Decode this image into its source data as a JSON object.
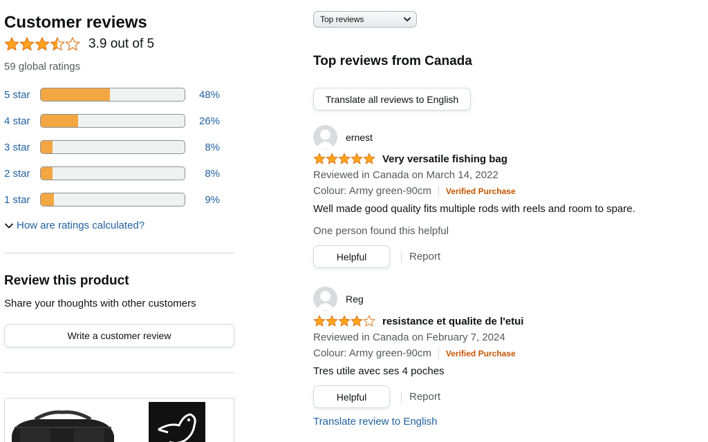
{
  "summary": {
    "title": "Customer reviews",
    "average_rating": 3.9,
    "average_text": "3.9 out of 5",
    "global_ratings": "59 global ratings",
    "histogram": [
      {
        "label": "5 star",
        "percent": 48,
        "percent_text": "48%"
      },
      {
        "label": "4 star",
        "percent": 26,
        "percent_text": "26%"
      },
      {
        "label": "3 star",
        "percent": 8,
        "percent_text": "8%"
      },
      {
        "label": "2 star",
        "percent": 8,
        "percent_text": "8%"
      },
      {
        "label": "1 star",
        "percent": 9,
        "percent_text": "9%"
      }
    ],
    "how_calculated": "How are ratings calculated?"
  },
  "review_product": {
    "title": "Review this product",
    "subtitle": "Share your thoughts with other customers",
    "button": "Write a customer review"
  },
  "sort": {
    "selected": "Top reviews"
  },
  "reviews_section": {
    "title": "Top reviews from Canada",
    "translate_all": "Translate all reviews to English"
  },
  "reviews": [
    {
      "author": "ernest",
      "rating": 5,
      "title": "Very versatile fishing bag",
      "date": "Reviewed in Canada on March 14, 2022",
      "variant": "Colour: Army green-90cm",
      "verified": "Verified Purchase",
      "body": "Well made good quality fits multiple rods with reels and room to spare.",
      "helpful_count": "One person found this helpful",
      "helpful_label": "Helpful",
      "report_label": "Report"
    },
    {
      "author": "Reg",
      "rating": 4,
      "title": "resistance et qualite de l'etui",
      "date": "Reviewed in Canada on February 7, 2024",
      "variant": "Colour: Army green-90cm",
      "verified": "Verified Purchase",
      "body": "Tres utile avec ses 4 poches",
      "helpful_label": "Helpful",
      "report_label": "Report",
      "translate": "Translate review to English"
    }
  ],
  "colors": {
    "star": "#FFA41C",
    "star_outline": "#DE7921",
    "bar_fill": "#F2A742",
    "link": "#2162A1",
    "verified": "#C45500"
  },
  "icons": {
    "star_full": "star-full-icon",
    "star_empty": "star-empty-icon",
    "chevron": "chevron-down-icon",
    "avatar": "default-avatar-icon"
  }
}
